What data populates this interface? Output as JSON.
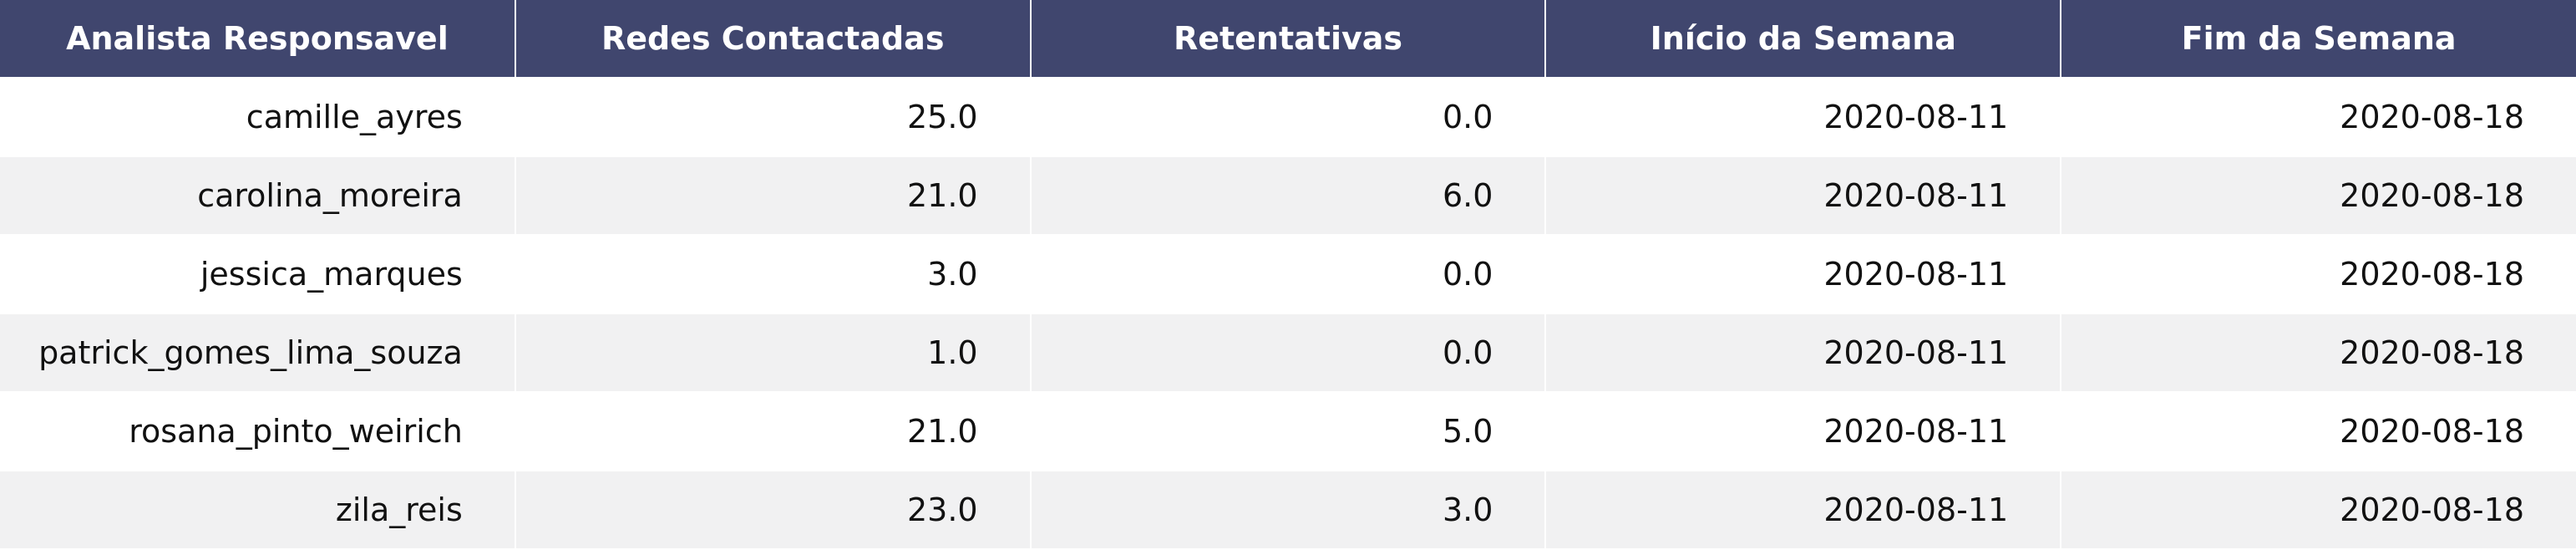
{
  "chart_data": {
    "type": "table",
    "colors": {
      "header_bg": "#40466e",
      "header_text": "#ffffff",
      "row_alt_bg": "#f1f1f2",
      "row_bg": "#ffffff"
    },
    "columns": [
      "Analista Responsavel",
      "Redes Contactadas",
      "Retentativas",
      "Início da Semana",
      "Fim da Semana"
    ],
    "rows": [
      [
        "camille_ayres",
        "25.0",
        "0.0",
        "2020-08-11",
        "2020-08-18"
      ],
      [
        "carolina_moreira",
        "21.0",
        "6.0",
        "2020-08-11",
        "2020-08-18"
      ],
      [
        "jessica_marques",
        "3.0",
        "0.0",
        "2020-08-11",
        "2020-08-18"
      ],
      [
        "patrick_gomes_lima_souza",
        "1.0",
        "0.0",
        "2020-08-11",
        "2020-08-18"
      ],
      [
        "rosana_pinto_weirich",
        "21.0",
        "5.0",
        "2020-08-11",
        "2020-08-18"
      ],
      [
        "zila_reis",
        "23.0",
        "3.0",
        "2020-08-11",
        "2020-08-18"
      ]
    ]
  }
}
